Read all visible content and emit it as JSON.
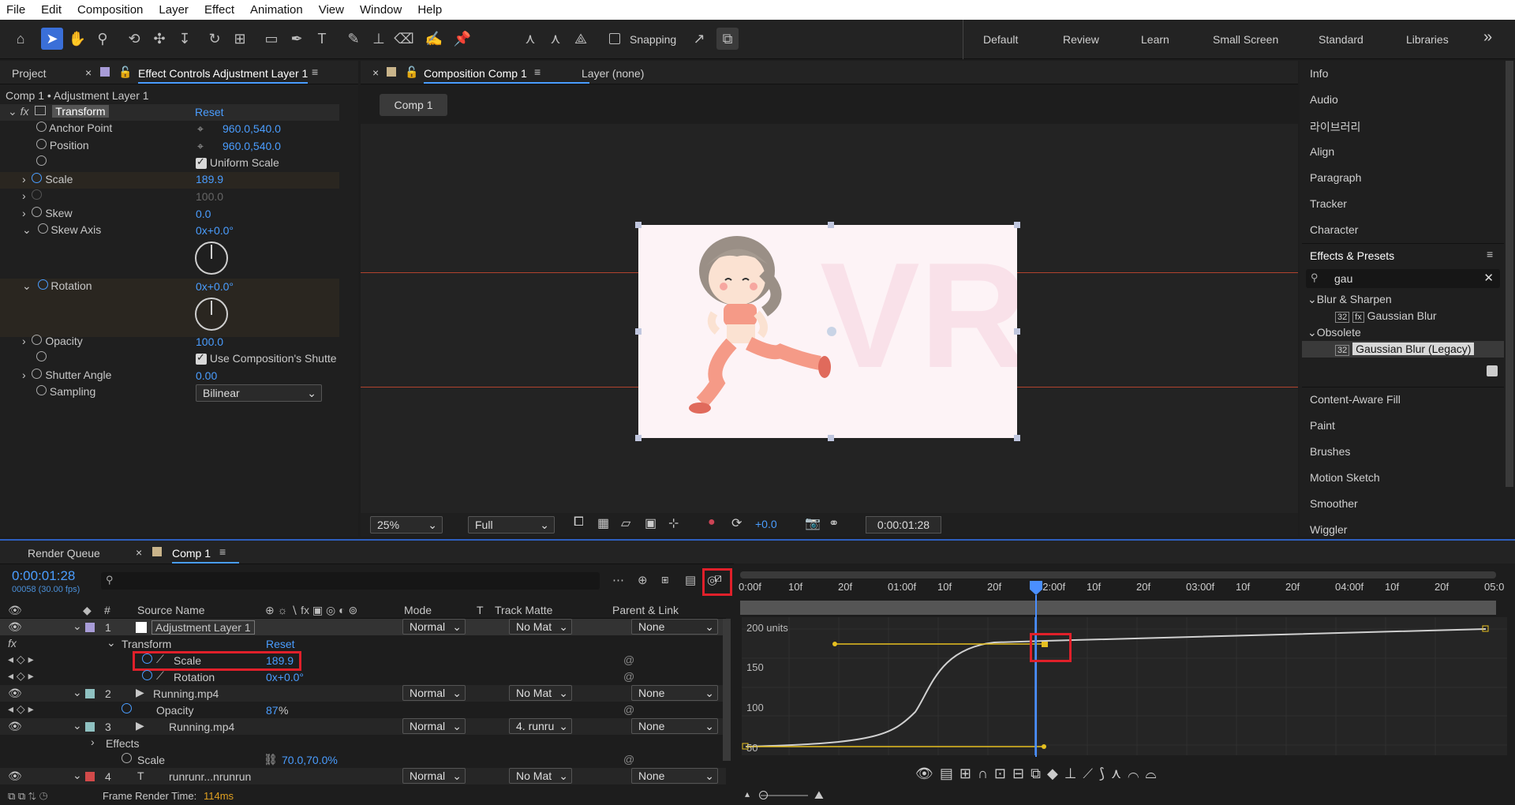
{
  "menu": [
    "File",
    "Edit",
    "Composition",
    "Layer",
    "Effect",
    "Animation",
    "View",
    "Window",
    "Help"
  ],
  "toolbar": {
    "snapping_label": "Snapping",
    "workspaces": [
      "Default",
      "Review",
      "Learn",
      "Small Screen",
      "Standard",
      "Libraries"
    ],
    "more": "»"
  },
  "left_panel": {
    "tab_project": "Project",
    "tab_effect_controls": "Effect Controls Adjustment Layer 1",
    "breadcrumb": "Comp 1 • Adjustment Layer 1",
    "effect_name": "Transform",
    "reset": "Reset",
    "props": {
      "anchor_label": "Anchor Point",
      "anchor_value": "960.0,540.0",
      "position_label": "Position",
      "position_value": "960.0,540.0",
      "uniform_scale": "Uniform Scale",
      "scale_label": "Scale",
      "scale_value": "189.9",
      "scale2_value": "100.0",
      "skew_label": "Skew",
      "skew_value": "0.0",
      "skew_axis_label": "Skew Axis",
      "skew_axis_value": "0x+0.0°",
      "rotation_label": "Rotation",
      "rotation_value": "0x+0.0°",
      "opacity_label": "Opacity",
      "opacity_value": "100.0",
      "use_comp_shutter": "Use Composition's Shutte",
      "shutter_label": "Shutter Angle",
      "shutter_value": "0.00",
      "sampling_label": "Sampling",
      "sampling_value": "Bilinear"
    }
  },
  "comp_panel": {
    "tab_comp": "Composition Comp 1",
    "tab_layer": "Layer (none)",
    "breadcrumb": "Comp 1",
    "zoom": "25%",
    "resolution": "Full",
    "exposure": "+0.0",
    "timecode": "0:00:01:28"
  },
  "right_panel": {
    "items_top": [
      "Info",
      "Audio",
      "라이브러리",
      "Align",
      "Paragraph",
      "Tracker",
      "Character"
    ],
    "effects_title": "Effects & Presets",
    "search_value": "gau",
    "cat1": "Blur & Sharpen",
    "item1": "Gaussian Blur",
    "cat2": "Obsolete",
    "item2": "Gaussian Blur (Legacy)",
    "items_bottom": [
      "Content-Aware Fill",
      "Paint",
      "Brushes",
      "Motion Sketch",
      "Smoother",
      "Wiggler"
    ]
  },
  "timeline": {
    "tab_render": "Render Queue",
    "tab_comp": "Comp 1",
    "timecode": "0:00:01:28",
    "frame_info": "00058 (30.00 fps)",
    "col_source": "Source Name",
    "col_mode": "Mode",
    "col_t": "T",
    "col_matte": "Track Matte",
    "col_parent": "Parent & Link",
    "layer1_num": "1",
    "layer1_name": "Adjustment Layer 1",
    "layer1_mode": "Normal",
    "layer1_matte": "No Mat",
    "layer1_parent": "None",
    "transform": "Transform",
    "reset": "Reset",
    "scale_label": "Scale",
    "scale_value": "189.9",
    "rotation_label": "Rotation",
    "rotation_value": "0x+0.0°",
    "layer2_num": "2",
    "layer2_name": "Running.mp4",
    "layer2_mode": "Normal",
    "layer2_matte": "No Mat",
    "layer2_parent": "None",
    "opacity_label": "Opacity",
    "opacity_value": "87",
    "layer3_num": "3",
    "layer3_name": "Running.mp4",
    "layer3_mode": "Normal",
    "layer3_matte": "4. runru",
    "layer3_parent": "None",
    "effects": "Effects",
    "scale3_label": "Scale",
    "scale3_value": "70.0,70.0%",
    "layer4_num": "4",
    "layer4_name": "runrunr...nrunrun",
    "layer4_mode": "Normal",
    "layer4_matte": "No Mat",
    "layer4_parent": "None",
    "render_time_label": "Frame Render Time:",
    "render_time_value": "114ms",
    "ruler": [
      "0:00f",
      "10f",
      "20f",
      "01:00f",
      "10f",
      "20f",
      "02:00f",
      "10f",
      "20f",
      "03:00f",
      "10f",
      "20f",
      "04:00f",
      "10f",
      "20f",
      "05:0"
    ],
    "graph_labels": [
      "200 units",
      "150",
      "100",
      "50"
    ]
  }
}
